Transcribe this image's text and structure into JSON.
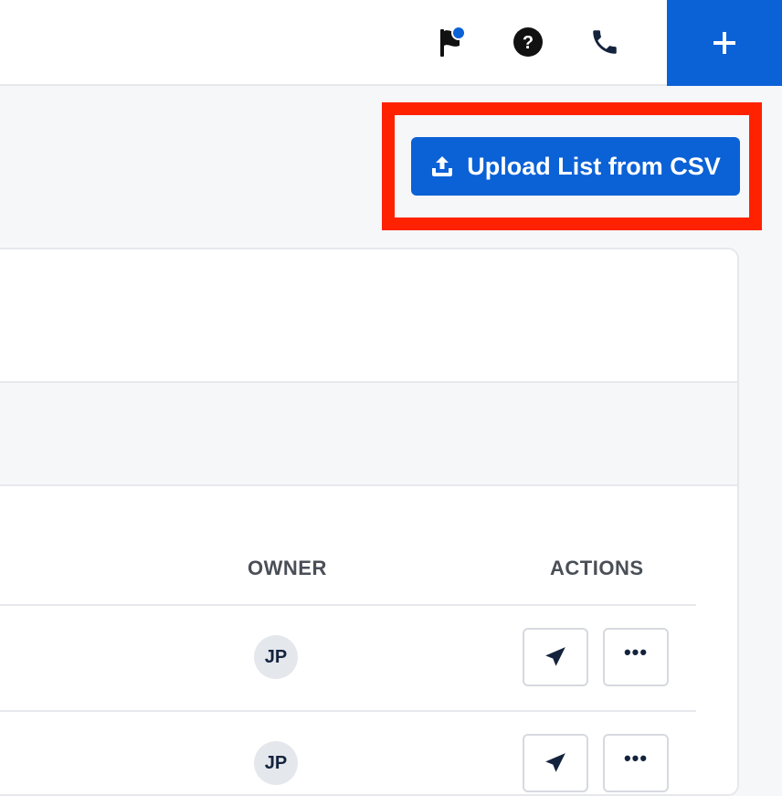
{
  "colors": {
    "brand_blue": "#0b61d6",
    "dark_navy": "#14233d",
    "notification_dot": "#0b61d6",
    "highlight_red": "#ff2200"
  },
  "topbar": {
    "icons": [
      "flag-icon",
      "help-icon",
      "phone-icon"
    ],
    "add_button_icon": "plus-icon",
    "add_button_symbol": "+"
  },
  "toolbar": {
    "upload_label": "Upload List from CSV",
    "upload_icon": "upload-icon"
  },
  "table": {
    "columns": [
      "OWNER",
      "ACTIONS"
    ],
    "rows": [
      {
        "owner_initials": "JP",
        "actions": [
          "send-icon",
          "more-icon"
        ]
      },
      {
        "owner_initials": "JP",
        "actions": [
          "send-icon",
          "more-icon"
        ]
      }
    ],
    "more_symbol": "•••"
  }
}
